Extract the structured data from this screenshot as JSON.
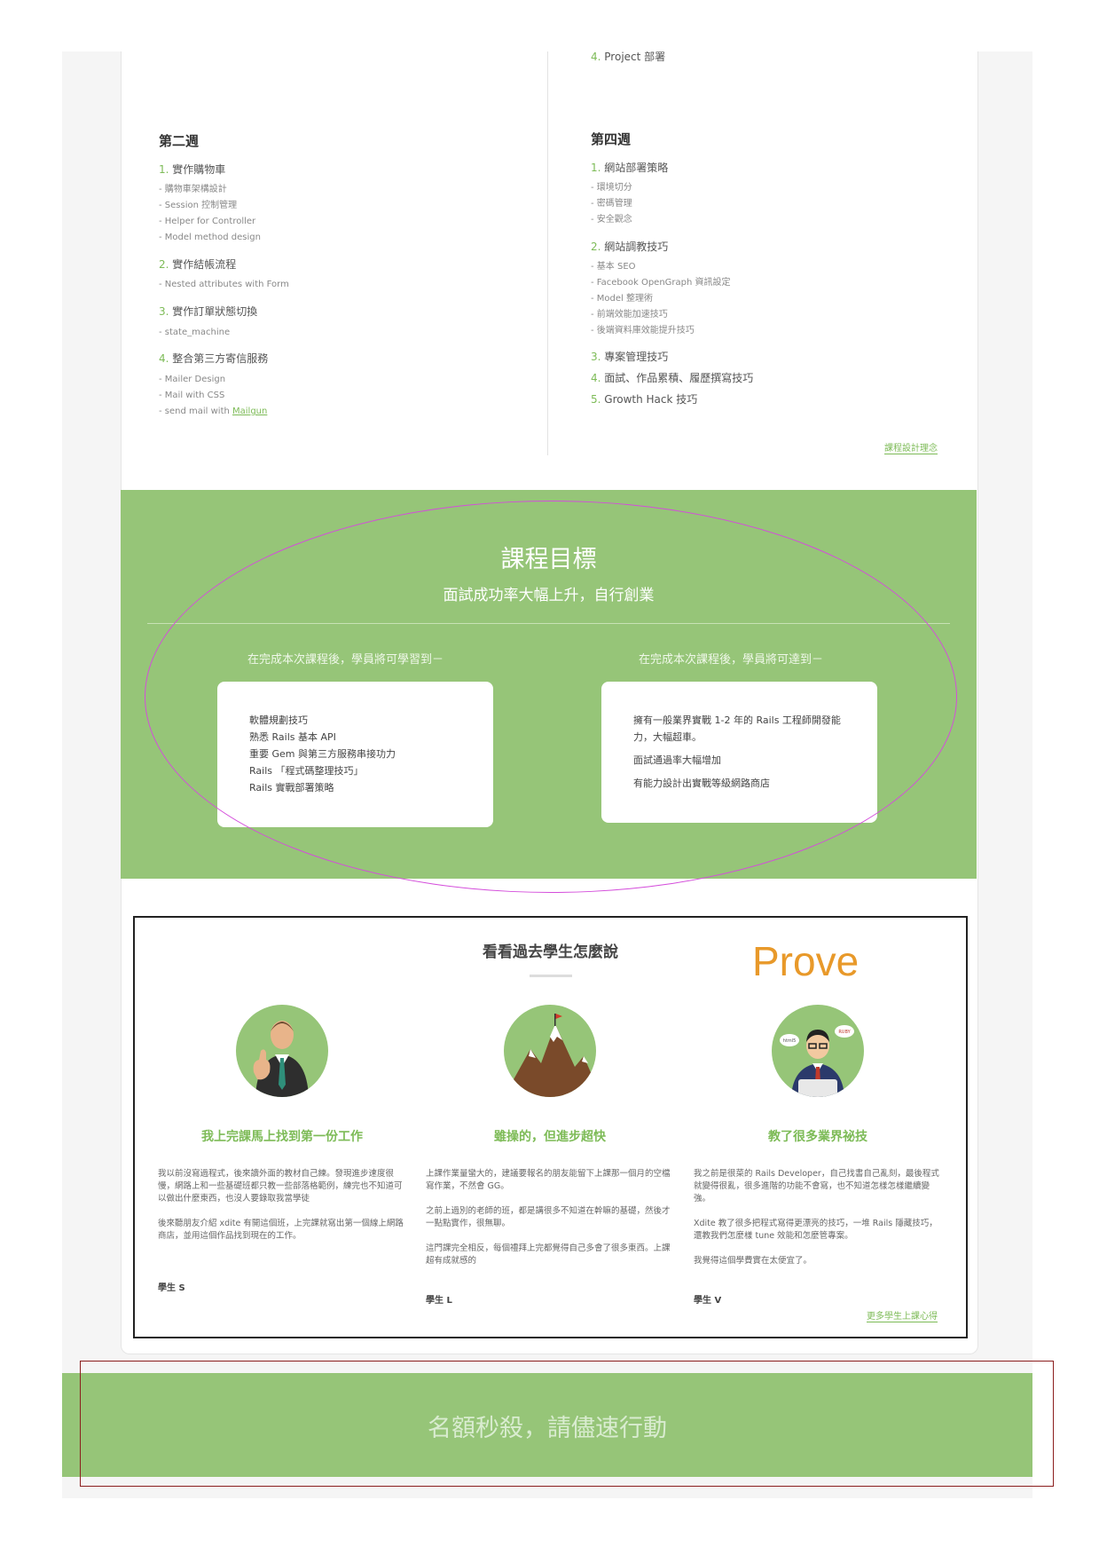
{
  "week2": {
    "title": "第二週",
    "items": [
      {
        "num": "1.",
        "label": "實作購物車",
        "subs": [
          "- 購物車架構設計",
          "- Session 控制管理",
          "- Helper for Controller",
          "- Model method design"
        ]
      },
      {
        "num": "2.",
        "label": "實作結帳流程",
        "subs": [
          "- Nested attributes with Form"
        ]
      },
      {
        "num": "3.",
        "label": "實作訂單狀態切換",
        "subs": [
          "- state_machine"
        ]
      },
      {
        "num": "4.",
        "label": "整合第三方寄信服務",
        "subs": [
          "- Mailer Design",
          "- Mail with CSS"
        ]
      }
    ],
    "last_sub_prefix": "- send mail with ",
    "last_sub_link": "Mailgun"
  },
  "week3_tail": {
    "num": "4.",
    "label": "Project 部署"
  },
  "week4": {
    "title": "第四週",
    "items": [
      {
        "num": "1.",
        "label": "網站部署策略",
        "subs": [
          "- 環境切分",
          "- 密碼管理",
          "- 安全觀念"
        ]
      },
      {
        "num": "2.",
        "label": "網站調教技巧",
        "subs": [
          "- 基本 SEO",
          "- Facebook OpenGraph 資訊設定",
          "- Model 整理術",
          "- 前端效能加速技巧",
          "- 後端資料庫效能提升技巧"
        ]
      },
      {
        "num": "3.",
        "label": "專案管理技巧"
      },
      {
        "num": "4.",
        "label": "面試、作品累積、履歷撰寫技巧"
      },
      {
        "num": "5.",
        "label": "Growth Hack 技巧"
      }
    ]
  },
  "course_design_link": "課程設計理念",
  "goal": {
    "title": "課程目標",
    "subtitle": "面試成功率大幅上升，自行創業",
    "left_head": "在完成本次課程後，學員將可學習到－",
    "right_head": "在完成本次課程後，學員將可達到－",
    "left_items": [
      "軟體規劃技巧",
      "熟悉 Rails 基本 API",
      "重要 Gem 與第三方服務串接功力",
      "Rails 「程式碼整理技巧」",
      "Rails 實戰部署策略"
    ],
    "right_items": [
      "擁有一般業界實戰 1-2 年的 Rails 工程師開發能力，大幅超車。",
      "面試通過率大幅增加",
      "有能力設計出實戰等級網路商店"
    ]
  },
  "testimonials": {
    "title": "看看過去學生怎麼說",
    "annotation": "Prove",
    "items": [
      {
        "heading": "我上完課馬上找到第一份工作",
        "paragraphs": [
          "我以前沒寫過程式，後來讀外面的教材自己練。發現進步速度很慢，網路上和一些基礎班都只教一些部落格範例，練完也不知道可以做出什麼東西，也沒人要錄取我當學徒",
          "後來聽朋友介紹 xdite 有開這個班，上完課就寫出第一個線上網路商店，並用這個作品找到現在的工作。"
        ],
        "name": "學生 S"
      },
      {
        "heading": "雖操的，但進步超快",
        "paragraphs": [
          "上課作業量蠻大的，建議要報名的朋友能留下上課那一個月的空檔寫作業，不然會 GG。",
          "之前上過別的老師的班，都是講很多不知道在幹嘛的基礎，然後才一點點實作，很無聊。",
          "這門課完全相反，每個禮拜上完都覺得自己多會了很多東西。上課超有成就感的"
        ],
        "name": "學生 L"
      },
      {
        "heading": "教了很多業界祕技",
        "paragraphs": [
          "我之前是很菜的 Rails Developer，自己找書自己亂刻，最後程式就變得很亂，很多進階的功能不會寫，也不知道怎樣怎樣繼續變強。",
          "Xdite 教了很多把程式寫得更漂亮的技巧，一堆 Rails 隱藏技巧，還教我們怎麼樣 tune 效能和怎麼管專案。",
          "我覺得這個學費實在太便宜了。"
        ],
        "name": "學生 V"
      }
    ],
    "more_link": "更多學生上課心得"
  },
  "banner": {
    "text": "名額秒殺，請儘速行動"
  },
  "colors": {
    "green": "#96c578",
    "accent_green": "#7dbb57",
    "annotation_orange": "#e8992a",
    "ellipse_magenta": "#d44ddb",
    "rect_red": "#8b1e1e"
  }
}
